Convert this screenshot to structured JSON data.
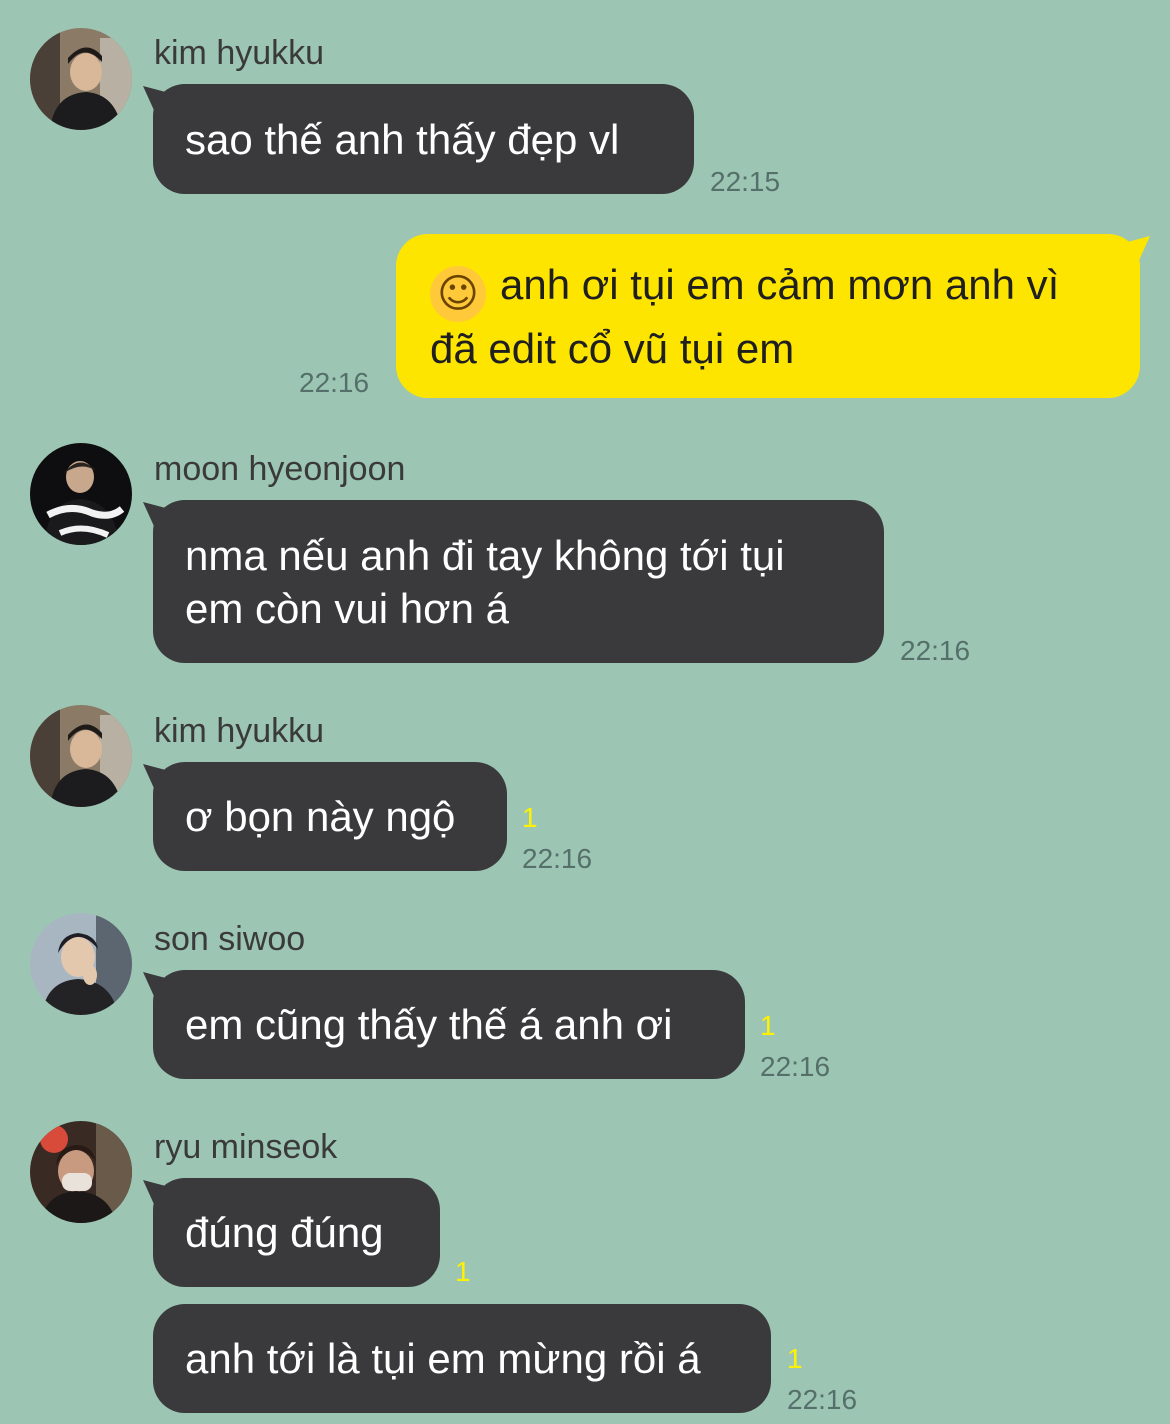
{
  "colors": {
    "background": "#9cc6b3",
    "incoming_bubble": "#3a3a3c",
    "outgoing_bubble": "#fee500",
    "unread_count": "#fff200"
  },
  "messages": [
    {
      "sender": "kim hyukku",
      "text": "sao thế anh thấy đẹp vl",
      "time": "22:15"
    },
    {
      "outgoing": true,
      "emoji": "☺",
      "text": "anh ơi tụi em cảm mơn anh vì đã edit cổ vũ tụi em",
      "time": "22:16"
    },
    {
      "sender": "moon hyeonjoon",
      "text": "nma nếu anh đi tay không tới tụi em còn vui hơn á",
      "time": "22:16"
    },
    {
      "sender": "kim hyukku",
      "text": "ơ bọn này ngộ",
      "unread": "1",
      "time": "22:16"
    },
    {
      "sender": "son siwoo",
      "text": "em cũng thấy thế á anh ơi",
      "unread": "1",
      "time": "22:16"
    },
    {
      "sender": "ryu minseok",
      "text": "đúng đúng",
      "unread": "1"
    },
    {
      "text": "anh tới là tụi em mừng rồi á",
      "unread": "1",
      "time": "22:16"
    }
  ]
}
